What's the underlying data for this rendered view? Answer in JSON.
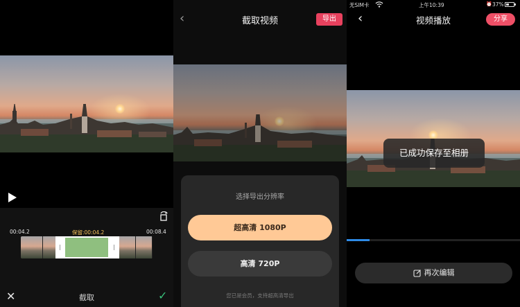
{
  "trim_screen": {
    "play_icon": "play-icon",
    "rotate_icon": "rotate-icon",
    "start_time": "00:04.2",
    "keep_duration": "保留:00:04.2",
    "end_time": "00:08.4",
    "cancel_icon": "close-icon",
    "cancel_glyph": "✕",
    "title": "截取",
    "confirm_icon": "check-icon",
    "confirm_glyph": "✓",
    "trim_fraction_start": 0.26,
    "trim_fraction_end": 0.75
  },
  "crop_screen": {
    "back_glyph": "‹",
    "title": "截取视频",
    "export_label": "导出",
    "accent": "#e8415e",
    "sheet": {
      "title": "选择导出分辨率",
      "option_1080": "超高清 1080P",
      "option_720": "高清 720P",
      "member_note": "您已是会员，支持超高清导出"
    }
  },
  "playback_screen": {
    "status": {
      "carrier": "无SIM卡",
      "time": "上午10:39",
      "battery": "37%",
      "battery_level": 0.37
    },
    "back_glyph": "‹",
    "title": "视频播放",
    "share_label": "分享",
    "toast": "已成功保存至相册",
    "progress_fraction": 0.13,
    "progress_color": "#2e8ae6",
    "reedit_label": "再次编辑",
    "reedit_icon": "edit-icon"
  }
}
